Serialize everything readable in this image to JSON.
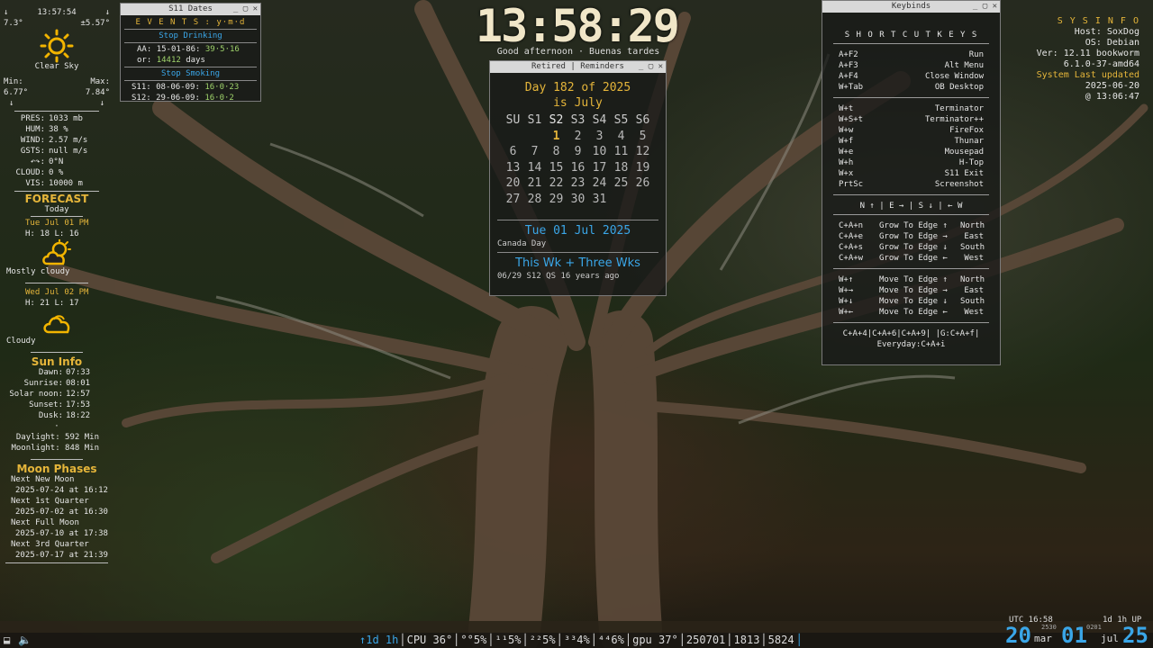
{
  "weather": {
    "time": "13:57:54",
    "temp": "7.3°",
    "temp_delta": "±5.57°",
    "condition": "Clear Sky",
    "min_label": "Min:",
    "max_label": "Max:",
    "min": "6.77°",
    "max": "7.84°",
    "details": [
      [
        "PRES:",
        "1033 mb"
      ],
      [
        "HUM:",
        "38 %"
      ],
      [
        "WIND:",
        "2.57 m/s"
      ],
      [
        "GSTS:",
        "null m/s"
      ],
      [
        "↶↷:",
        "0°N"
      ],
      [
        "CLOUD:",
        "0 %"
      ],
      [
        "VIS:",
        "10000 m"
      ]
    ],
    "forecast_title": "FORECAST",
    "today_label": "Today",
    "fc1_date": "Tue Jul 01 PM",
    "fc1_hl": "H: 18   L: 16",
    "fc1_cond": "Mostly cloudy",
    "fc2_date": "Wed Jul 02 PM",
    "fc2_hl": "H: 21   L: 17",
    "fc2_cond": "Cloudy",
    "sun_title": "Sun Info",
    "sun": [
      [
        "Dawn:",
        "07:33"
      ],
      [
        "Sunrise:",
        "08:01"
      ],
      [
        "Solar noon:",
        "12:57"
      ],
      [
        "Sunset:",
        "17:53"
      ],
      [
        "Dusk:",
        "18:22"
      ]
    ],
    "daylight": "Daylight: 592 Min",
    "moonlight": "Moonlight: 848 Min",
    "moon_title": "Moon Phases",
    "moon": [
      [
        "Next New Moon",
        "2025-07-24 at 16:12"
      ],
      [
        "Next 1st Quarter",
        "2025-07-02 at 16:30"
      ],
      [
        "Next Full Moon",
        "2025-07-10 at 17:38"
      ],
      [
        "Next 3rd Quarter",
        "2025-07-17 at 21:39"
      ]
    ]
  },
  "s11": {
    "title": "S11 Dates",
    "events": "E V E N T S : y·m·d",
    "stop_drinking": "Stop Drinking",
    "aa_label": "AA:",
    "aa_date": "15-01-86:",
    "aa_val": "39·5·16",
    "or_label": "or:",
    "or_val": "14412",
    "or_unit": "days",
    "stop_smoking": "Stop Smoking",
    "s11_label": "S11:",
    "s11_date": "08-06-09:",
    "s11_val": "16·0·23",
    "s12_label": "S12:",
    "s12_date": "29-06-09:",
    "s12_val": "16·0·2"
  },
  "clock": {
    "time": "13:58:29",
    "greeting": "Good afternoon · Buenas tardes"
  },
  "calendar": {
    "title": "Retired | Reminders",
    "day_line": "Day 182 of 2025",
    "month_line": "is July",
    "headers": [
      "SU",
      "S1",
      "S2",
      "S3",
      "S4",
      "S5",
      "S6"
    ],
    "days": [
      "",
      "",
      "1",
      "2",
      "3",
      "4",
      "5",
      "6",
      "7",
      "8",
      "9",
      "10",
      "11",
      "12",
      "13",
      "14",
      "15",
      "16",
      "17",
      "18",
      "19",
      "20",
      "21",
      "22",
      "23",
      "24",
      "25",
      "26",
      "27",
      "28",
      "29",
      "30",
      "31",
      "",
      ""
    ],
    "today": "1",
    "date": "Tue 01 Jul 2025",
    "holiday": "Canada Day",
    "week_title": "This Wk + Three Wks",
    "week_note": "06/29 S12 QS 16 years ago"
  },
  "keybinds": {
    "title": "Keybinds",
    "heading": "S H O R T C U T   K E Y S",
    "group1": [
      [
        "A+F2",
        "Run"
      ],
      [
        "A+F3",
        "Alt Menu"
      ],
      [
        "A+F4",
        "Close Window"
      ],
      [
        "W+Tab",
        "OB Desktop"
      ]
    ],
    "group2": [
      [
        "W+t",
        "Terminator"
      ],
      [
        "W+S+t",
        "Terminator++"
      ],
      [
        "W+w",
        "FireFox"
      ],
      [
        "W+f",
        "Thunar"
      ],
      [
        "W+e",
        "Mousepad"
      ],
      [
        "W+h",
        "H-Top"
      ],
      [
        "W+x",
        "S11 Exit"
      ],
      [
        "PrtSc",
        "Screenshot"
      ]
    ],
    "dirs": "N ↑ | E → | S ↓ | ← W",
    "group3": [
      [
        "C+A+n",
        "Grow To Edge ↑",
        "North"
      ],
      [
        "C+A+e",
        "Grow To Edge →",
        "East"
      ],
      [
        "C+A+s",
        "Grow To Edge ↓",
        "South"
      ],
      [
        "C+A+w",
        "Grow To Edge ←",
        "West"
      ]
    ],
    "group4": [
      [
        "W+↑",
        "Move To Edge ↑",
        "North"
      ],
      [
        "W+→",
        "Move To Edge →",
        "East"
      ],
      [
        "W+↓",
        "Move To Edge ↓",
        "South"
      ],
      [
        "W+←",
        "Move To Edge ←",
        "West"
      ]
    ],
    "footer1": "C+A+4|C+A+6|C+A+9| |G:C+A+f|",
    "footer2": "Everyday:C+A+i"
  },
  "sysinfo": {
    "title": "S Y S   I N F O",
    "host": "Host: SoxDog",
    "os": "OS: Debian",
    "ver": "Ver: 12.11 bookworm",
    "kernel": "6.1.0-37-amd64",
    "updated_label": "System Last updated",
    "updated_date": "2025-06-20",
    "updated_time": "@ 13:06:47"
  },
  "taskbar": {
    "uptime": "↑1d 1h",
    "cpu": "CPU 36°",
    "c1": "°°5%",
    "c2": "¹¹5%",
    "c3": "²²5%",
    "c4": "³³4%",
    "c5": "⁴⁴6%",
    "gpu": "gpu 37°",
    "n1": "250701",
    "n2": "1813",
    "n3": "5824",
    "utc": "UTC 16:58",
    "uptime_right": "1d 1h UP",
    "date_big1": "20",
    "date_small1": "mar",
    "date_big2": "01",
    "date_small2": "jul",
    "date_big3": "25",
    "small_time": "2530",
    "small_num": "0201"
  },
  "colors": {
    "gold": "#e5b53a",
    "blue": "#3aa6e8",
    "green": "#9fd36b"
  }
}
